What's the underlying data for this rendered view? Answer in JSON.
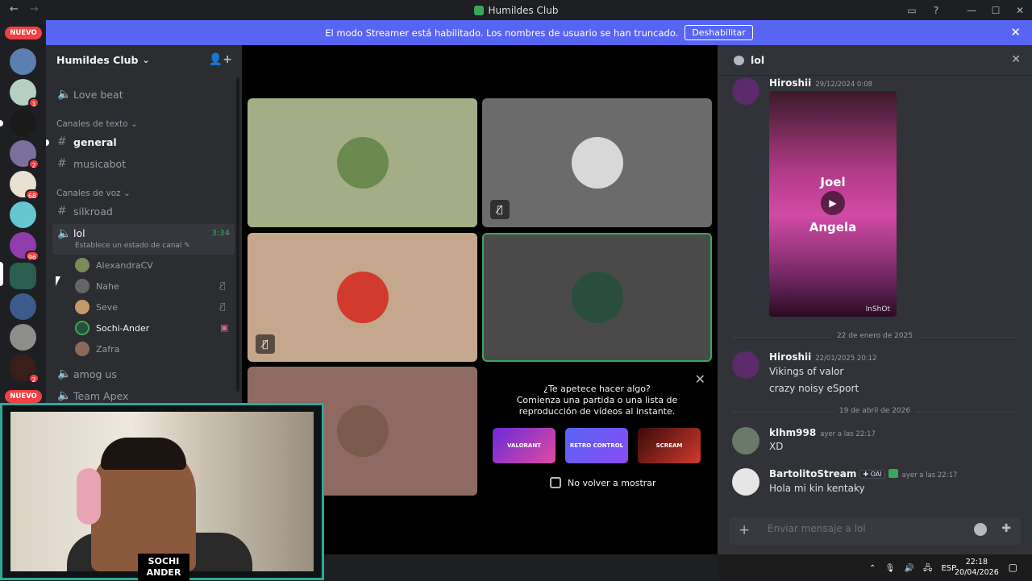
{
  "window": {
    "title": "Humildes Club",
    "back_icon": "←",
    "forward_icon": "→",
    "inbox_icon": "▭",
    "help_icon": "?",
    "minimize_icon": "—",
    "maximize_icon": "☐",
    "close_icon": "✕"
  },
  "banner": {
    "text": "El modo Streamer está habilitado. Los nombres de usuario se han truncado.",
    "button": "Deshabilitar",
    "close_icon": "✕"
  },
  "servers": {
    "nuevo_top": "NUEVO",
    "nuevo_bottom": "NUEVO",
    "badges": [
      "1",
      "2",
      "68",
      "96",
      "2"
    ]
  },
  "sidebar": {
    "server_name": "Humildes Club",
    "chevron": "⌄",
    "invite_icon": "👤+",
    "channels_top": [
      {
        "name": "Love beat",
        "type": "voice"
      }
    ],
    "text_category": "Canales de texto",
    "text_channels": [
      "general",
      "musicabot"
    ],
    "voice_category": "Canales de voz",
    "voice_channels_before": [
      "silkroad"
    ],
    "active_voice": {
      "name": "lol",
      "time": "3:34",
      "status": "Establece un estado de canal ✎"
    },
    "voice_users": [
      "AlexandraCV",
      "Nahe",
      "Seve",
      "Sochi-Ander",
      "Zafra"
    ],
    "voice_channels_after": [
      "amog us",
      "Team Apex"
    ],
    "muted_icon": "🎙̸",
    "stream_icon": "▣",
    "category_chevron": "⌄",
    "hash": "#",
    "speaker": "🔈"
  },
  "stage": {
    "mute_icon": "🎙̸",
    "activity": {
      "line1": "¿Te apetece hacer algo?",
      "line2": "Comienza una partida o una lista de",
      "line3": "reproducción de vídeos al instante.",
      "cards": [
        "VALORANT",
        "RETRO CONTROL",
        "SCREAM"
      ],
      "dont_show": "No volver a mostrar",
      "close": "✕"
    }
  },
  "chat": {
    "channel": "lol",
    "close_icon": "✕",
    "messages": [
      {
        "author": "Hiroshii",
        "time": "29/12/2024 0:08"
      },
      {
        "author": "Hiroshii",
        "time": "22/01/2025 20:12",
        "lines": [
          "Vikings of valor",
          "crazy noisy eSport"
        ]
      },
      {
        "author": "klhm998",
        "time": "ayer a las 22:17",
        "lines": [
          "XD"
        ]
      },
      {
        "author": "BartolitoStream",
        "tag": "✚ OAI",
        "time": "ayer a las 22:17",
        "lines": [
          "Hola mi kin kentaky"
        ]
      }
    ],
    "video": {
      "line1": "Joel",
      "line2": "Angela",
      "play": "▶",
      "watermark": "InShOt"
    },
    "dividers": [
      "22 de enero de 2025",
      "19 de abril de 2026"
    ],
    "composer": {
      "placeholder": "Enviar mensaje a lol",
      "plus": "+",
      "apps": "✚"
    }
  },
  "webcam": {
    "logo_line1": "SOCHI",
    "logo_line2": "ANDER"
  },
  "taskbar": {
    "chevron": "⌃",
    "mic": "🎙",
    "speaker": "🔊",
    "network": "🖧",
    "lang": "ESP",
    "time": "22:18",
    "date": "20/04/2026",
    "notif": "▢"
  }
}
